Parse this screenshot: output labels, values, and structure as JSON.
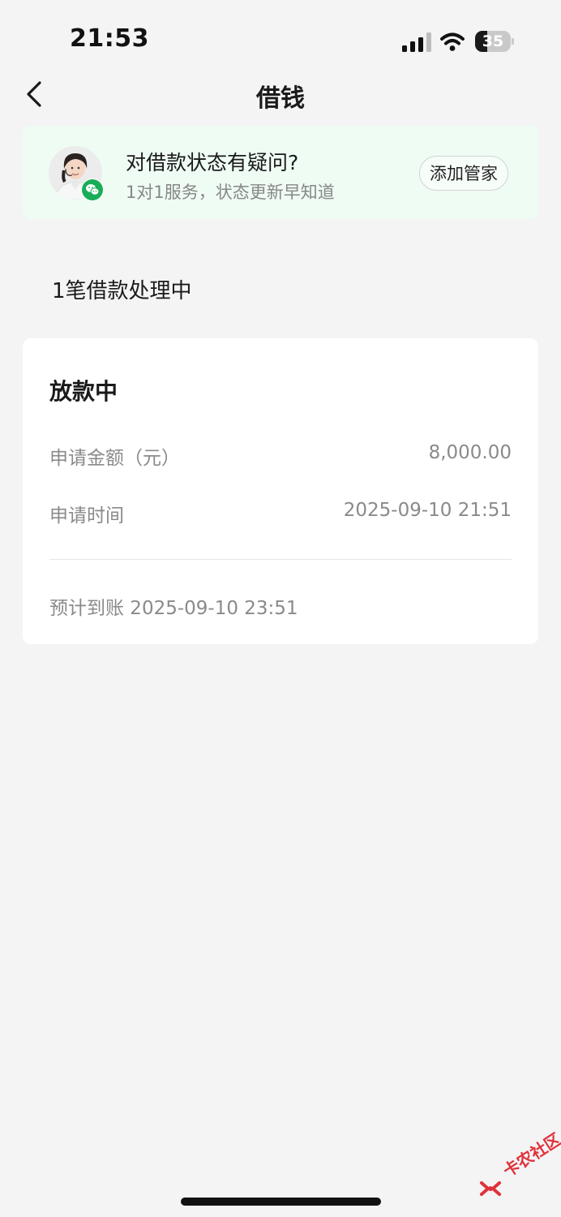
{
  "status_bar": {
    "time": "21:53",
    "battery_level": "35",
    "battery_fraction": 0.35,
    "icons": [
      "signal-icon",
      "wifi-icon",
      "battery-icon"
    ]
  },
  "nav": {
    "back_icon": "chevron-left-icon",
    "title": "借钱"
  },
  "banner": {
    "title": "对借款状态有疑问?",
    "subtitle": "1对1服务，状态更新早知道",
    "button_label": "添加管家",
    "badge_icon": "wechat-icon",
    "bg_color": "#eefcf4",
    "badge_color": "#1aad58"
  },
  "section": {
    "heading": "1笔借款处理中"
  },
  "loan_card": {
    "status": "放款中",
    "rows": [
      {
        "label": "申请金额（元）",
        "value": "8,000.00"
      },
      {
        "label": "申请时间",
        "value": "2025-09-10 21:51"
      }
    ],
    "eta": "预计到账 2025-09-10 23:51"
  },
  "watermark": {
    "text": "卡农社区",
    "color": "#e0313a"
  }
}
